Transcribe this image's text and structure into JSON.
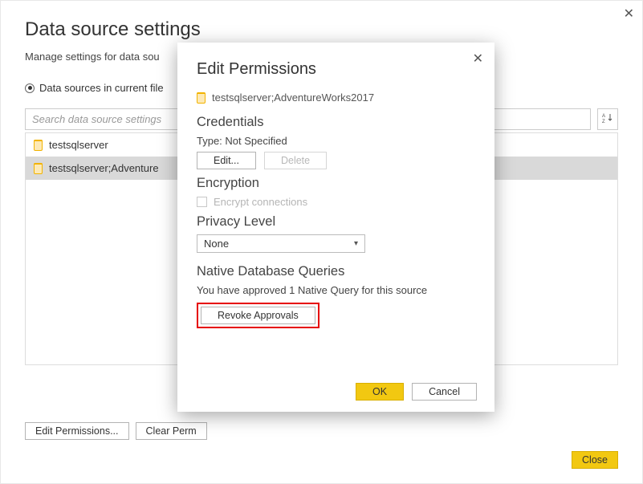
{
  "window": {
    "title": "Data source settings",
    "subtitle": "Manage settings for data sou",
    "radio_label": "Data sources in current file",
    "search_placeholder": "Search data source settings",
    "sort_label": "A↓Z"
  },
  "sources": [
    {
      "label": "testsqlserver"
    },
    {
      "label": "testsqlserver;Adventure"
    }
  ],
  "bottom": {
    "edit_permissions": "Edit Permissions...",
    "clear_permissions": "Clear Perm",
    "close": "Close"
  },
  "dialog": {
    "title": "Edit Permissions",
    "source": "testsqlserver;AdventureWorks2017",
    "credentials": {
      "head": "Credentials",
      "type_line": "Type: Not Specified",
      "edit": "Edit...",
      "delete": "Delete"
    },
    "encryption": {
      "head": "Encryption",
      "checkbox": "Encrypt connections"
    },
    "privacy": {
      "head": "Privacy Level",
      "value": "None"
    },
    "queries": {
      "head": "Native Database Queries",
      "msg": "You have approved 1 Native Query for this source",
      "revoke": "Revoke Approvals"
    },
    "ok": "OK",
    "cancel": "Cancel"
  }
}
